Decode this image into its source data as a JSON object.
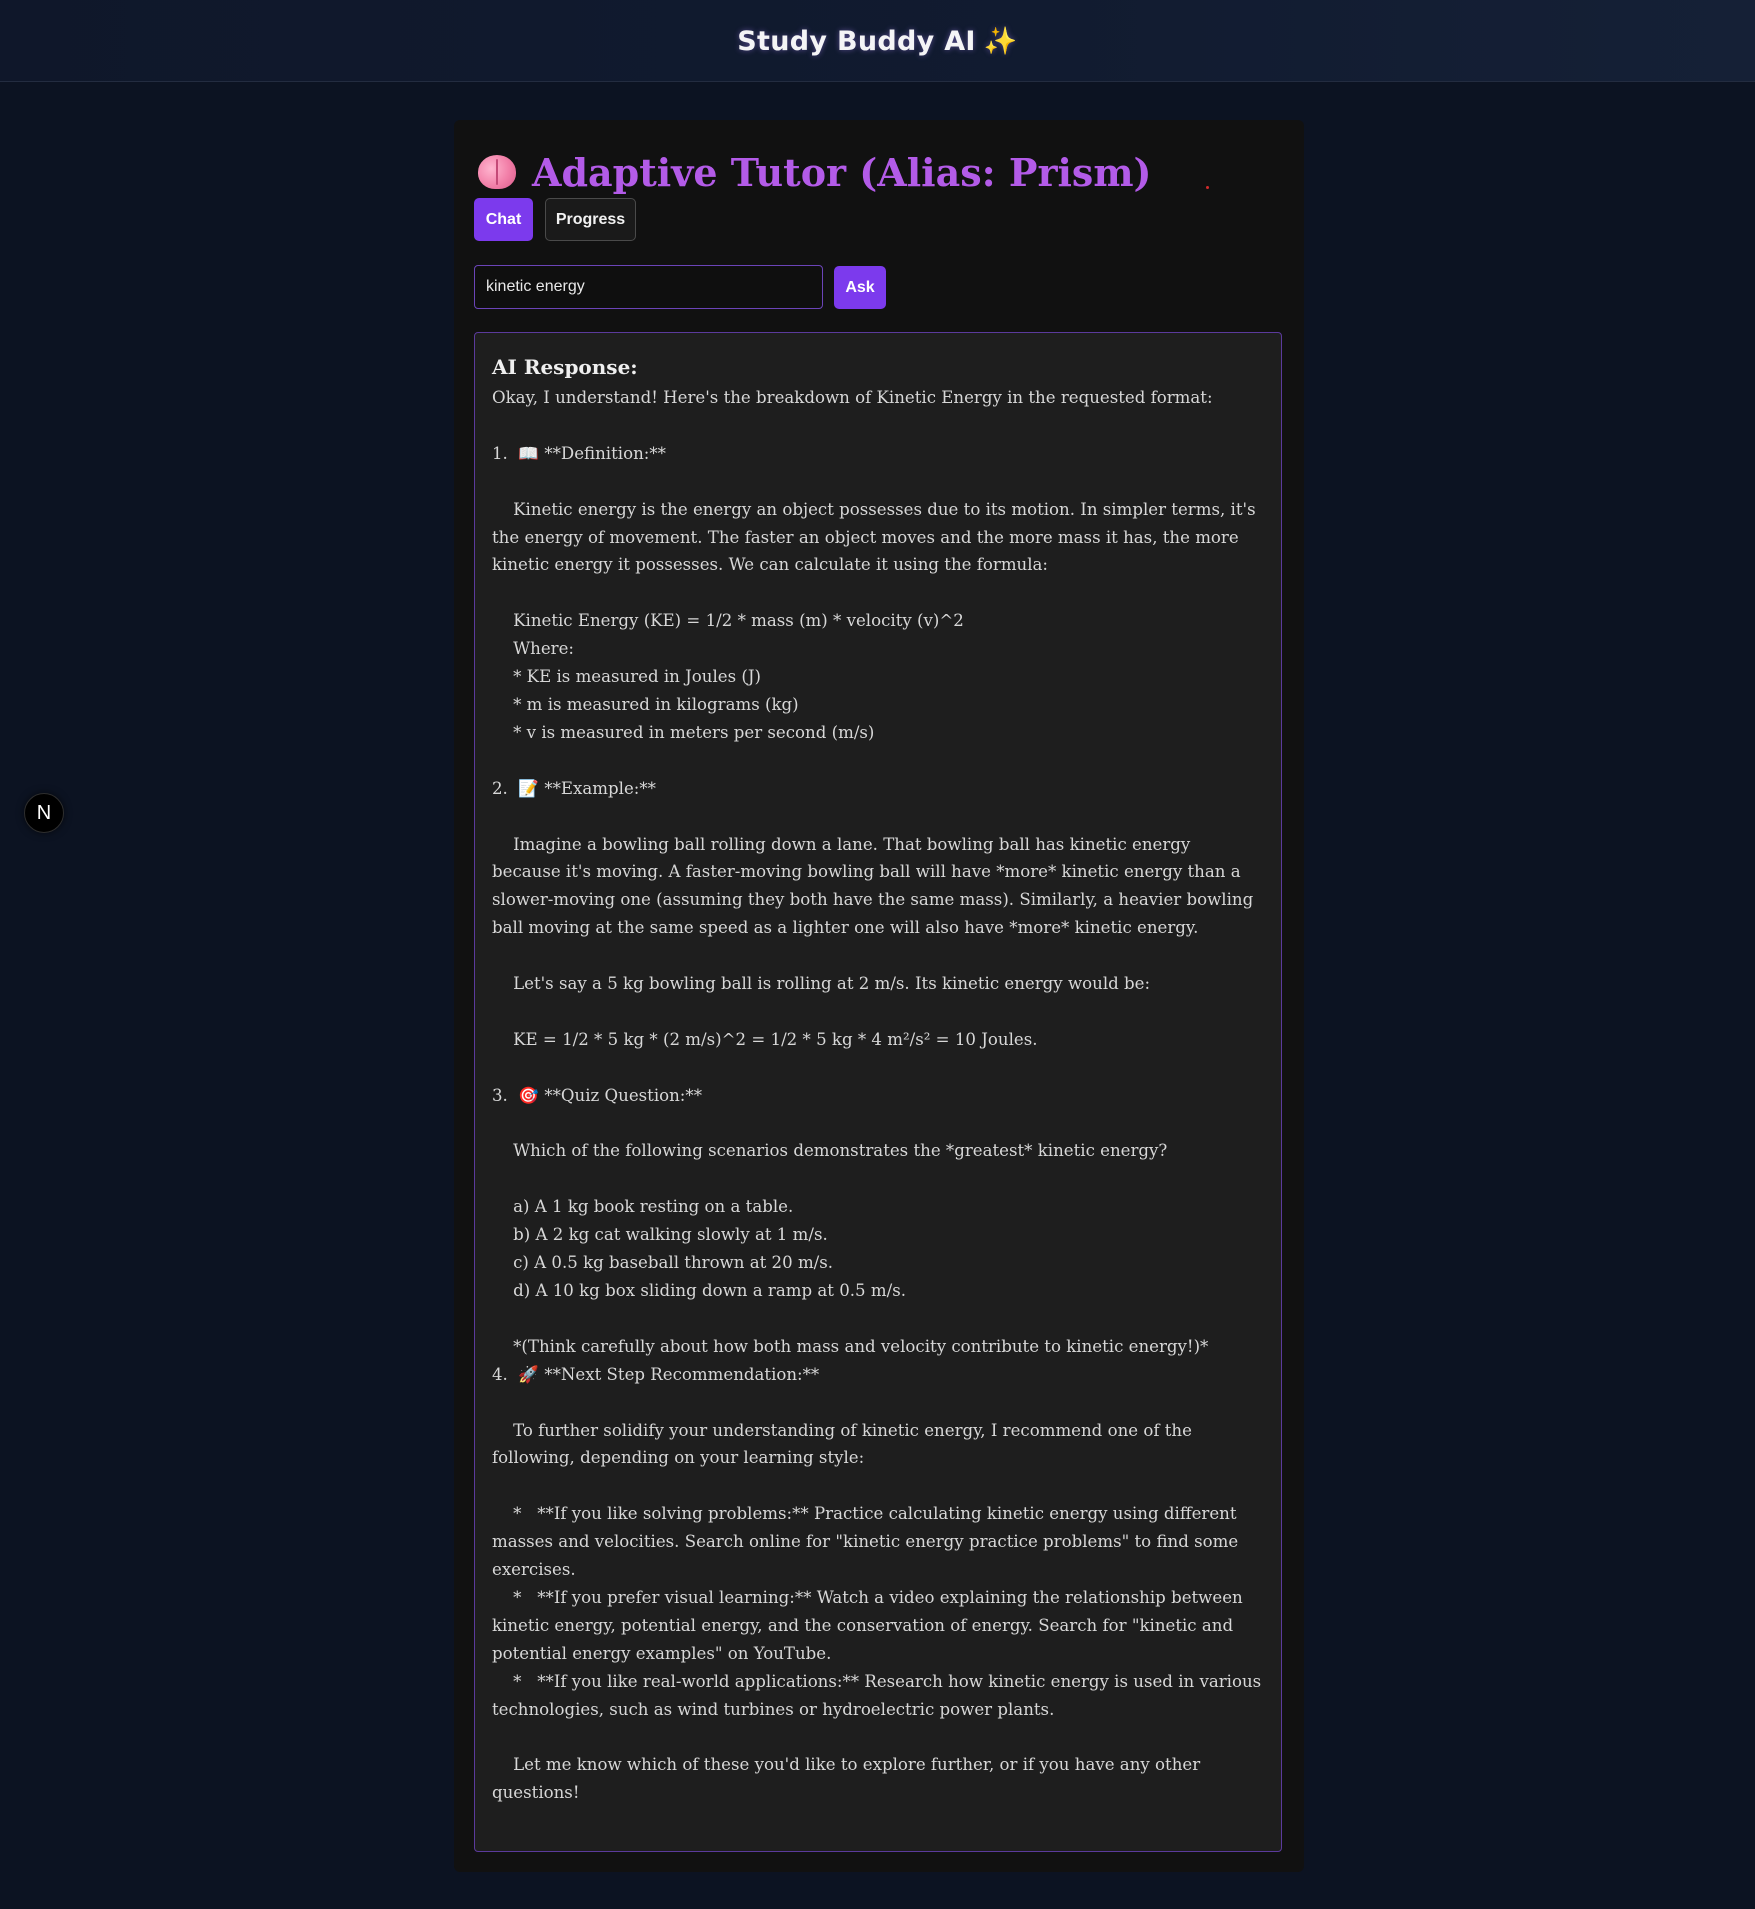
{
  "header": {
    "title": "Study Buddy AI",
    "title_icon": "✨"
  },
  "tutor": {
    "title": "Adaptive Tutor (Alias: Prism)",
    "icon": "brain-icon"
  },
  "tabs": [
    {
      "label": "Chat",
      "active": true
    },
    {
      "label": "Progress",
      "active": false
    }
  ],
  "search": {
    "value": "kinetic energy",
    "placeholder": "",
    "button_label": "Ask"
  },
  "response": {
    "heading": "AI Response:",
    "text": "Okay, I understand! Here's the breakdown of Kinetic Energy in the requested format:\n\n1.  📖 **Definition:**\n\n    Kinetic energy is the energy an object possesses due to its motion. In simpler terms, it's the energy of movement. The faster an object moves and the more mass it has, the more kinetic energy it possesses. We can calculate it using the formula:\n\n    Kinetic Energy (KE) = 1/2 * mass (m) * velocity (v)^2\n    Where:\n    * KE is measured in Joules (J)\n    * m is measured in kilograms (kg)\n    * v is measured in meters per second (m/s)\n\n2.  📝 **Example:**\n\n    Imagine a bowling ball rolling down a lane. That bowling ball has kinetic energy because it's moving. A faster-moving bowling ball will have *more* kinetic energy than a slower-moving one (assuming they both have the same mass). Similarly, a heavier bowling ball moving at the same speed as a lighter one will also have *more* kinetic energy.\n\n    Let's say a 5 kg bowling ball is rolling at 2 m/s. Its kinetic energy would be:\n\n    KE = 1/2 * 5 kg * (2 m/s)^2 = 1/2 * 5 kg * 4 m²/s² = 10 Joules.\n\n3.  🎯 **Quiz Question:**\n\n    Which of the following scenarios demonstrates the *greatest* kinetic energy?\n\n    a) A 1 kg book resting on a table.\n    b) A 2 kg cat walking slowly at 1 m/s.\n    c) A 0.5 kg baseball thrown at 20 m/s.\n    d) A 10 kg box sliding down a ramp at 0.5 m/s.\n\n    *(Think carefully about how both mass and velocity contribute to kinetic energy!)*\n4.  🚀 **Next Step Recommendation:**\n\n    To further solidify your understanding of kinetic energy, I recommend one of the following, depending on your learning style:\n\n    *   **If you like solving problems:** Practice calculating kinetic energy using different masses and velocities. Search online for \"kinetic energy practice problems\" to find some exercises.\n    *   **If you prefer visual learning:** Watch a video explaining the relationship between kinetic energy, potential energy, and the conservation of energy. Search for \"kinetic and potential energy examples\" on YouTube.\n    *   **If you like real-world applications:** Research how kinetic energy is used in various technologies, such as wind turbines or hydroelectric power plants.\n\n    Let me know which of these you'd like to explore further, or if you have any other questions!"
  },
  "dev_badge": {
    "label": "N"
  },
  "colors": {
    "accent": "#7c3aed",
    "title_purple": "#b35be8",
    "page_bg": "#0c1322",
    "card_bg": "#111111",
    "response_bg": "#1e1e1e"
  }
}
